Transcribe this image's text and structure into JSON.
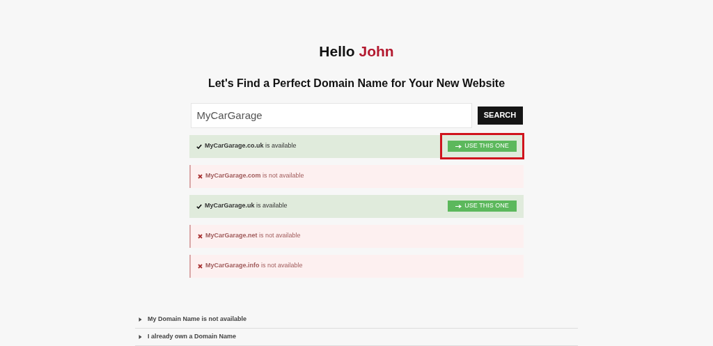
{
  "heading": {
    "greeting": "Hello",
    "name": "John"
  },
  "subheading": "Let's Find a Perfect Domain Name for Your New Website",
  "search": {
    "value": "MyCarGarage",
    "button": "SEARCH"
  },
  "results": [
    {
      "available": true,
      "text": "**MyCarGarage.co.uk** is available",
      "action": "USE THIS ONE",
      "highlighted": true
    },
    {
      "available": false,
      "text": "**MyCarGarage.com** is not available"
    },
    {
      "available": true,
      "text": "**MyCarGarage.uk** is available",
      "action": "USE THIS ONE",
      "highlighted": false
    },
    {
      "available": false,
      "text": "**MyCarGarage.net** is not available"
    },
    {
      "available": false,
      "text": "**MyCarGarage.info** is not available"
    }
  ],
  "accordion": [
    {
      "label": "My Domain Name is not available",
      "expanded": false
    },
    {
      "label": "I already own a Domain Name",
      "expanded": false
    }
  ]
}
